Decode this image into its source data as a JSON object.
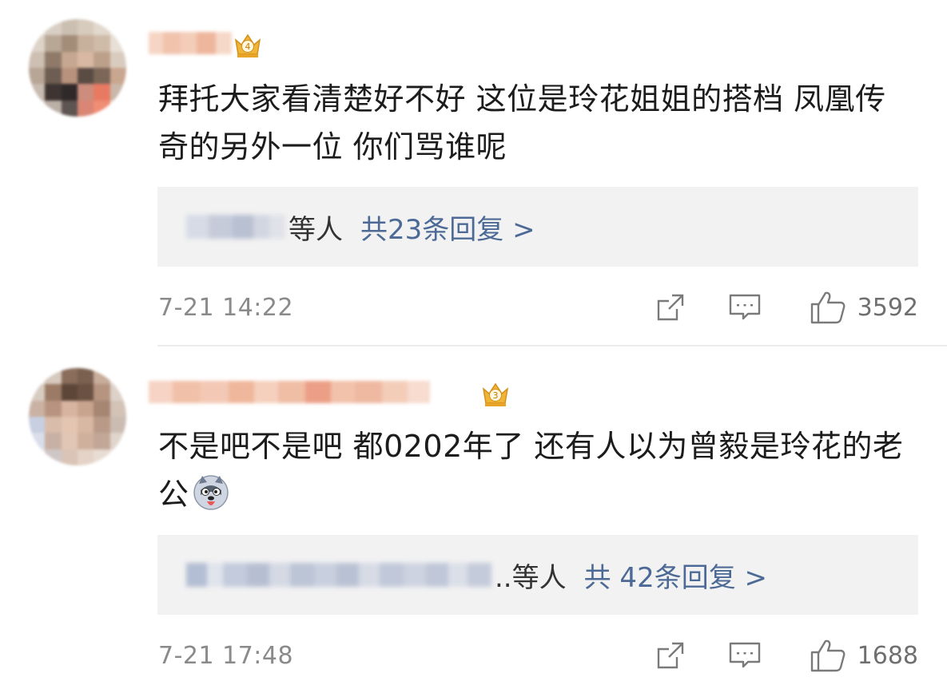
{
  "comments": [
    {
      "text": "拜托大家看清楚好不好 这位是玲花姐姐的搭档 凤凰传奇的另外一位 你们骂谁呢",
      "badge_level": "4",
      "reply_suffix": "等人",
      "reply_link": "共23条回复 >",
      "time": "7-21 14:22",
      "likes": "3592"
    },
    {
      "text": "不是吧不是吧 都0202年了 还有人以为曾毅是玲花的老公",
      "badge_level": "3",
      "emoji": "husky-emoji",
      "reply_suffix": "..等人",
      "reply_link": "共 42条回复 >",
      "time": "7-21 17:48",
      "likes": "1688"
    }
  ],
  "colors": {
    "link": "#4d6a96",
    "reply_bg": "#f2f2f2",
    "muted": "#8a8a8a",
    "badge_gold": "#f0b436"
  }
}
